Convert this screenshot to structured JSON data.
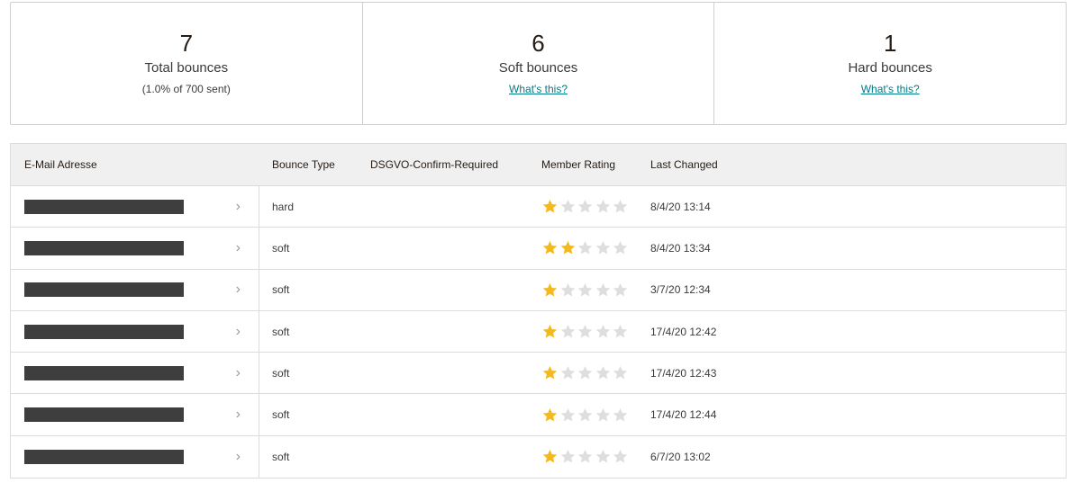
{
  "stats": [
    {
      "value": "7",
      "label": "Total bounces",
      "sub": "(1.0% of 700 sent)"
    },
    {
      "value": "6",
      "label": "Soft bounces",
      "link": "What's this?"
    },
    {
      "value": "1",
      "label": "Hard bounces",
      "link": "What's this?"
    }
  ],
  "table": {
    "headers": [
      "E-Mail Adresse",
      "Bounce Type",
      "DSGVO-Confirm-Required",
      "Member Rating",
      "Last Changed"
    ],
    "rows": [
      {
        "bounce_type": "hard",
        "dsgvo": "",
        "rating": 1,
        "rating_max": 5,
        "last_changed": "8/4/20 13:14"
      },
      {
        "bounce_type": "soft",
        "dsgvo": "",
        "rating": 2,
        "rating_max": 5,
        "last_changed": "8/4/20 13:34"
      },
      {
        "bounce_type": "soft",
        "dsgvo": "",
        "rating": 1,
        "rating_max": 5,
        "last_changed": "3/7/20 12:34"
      },
      {
        "bounce_type": "soft",
        "dsgvo": "",
        "rating": 1,
        "rating_max": 5,
        "last_changed": "17/4/20 12:42"
      },
      {
        "bounce_type": "soft",
        "dsgvo": "",
        "rating": 1,
        "rating_max": 5,
        "last_changed": "17/4/20 12:43"
      },
      {
        "bounce_type": "soft",
        "dsgvo": "",
        "rating": 1,
        "rating_max": 5,
        "last_changed": "17/4/20 12:44"
      },
      {
        "bounce_type": "soft",
        "dsgvo": "",
        "rating": 1,
        "rating_max": 5,
        "last_changed": "6/7/20 13:02"
      }
    ]
  },
  "icons": {
    "chevron": "chevron-right-icon",
    "star": "star-icon"
  },
  "colors": {
    "star_on": "#f6b91b",
    "star_off": "#dedede",
    "link": "#007c89",
    "redaction": "#3e3e3e"
  }
}
